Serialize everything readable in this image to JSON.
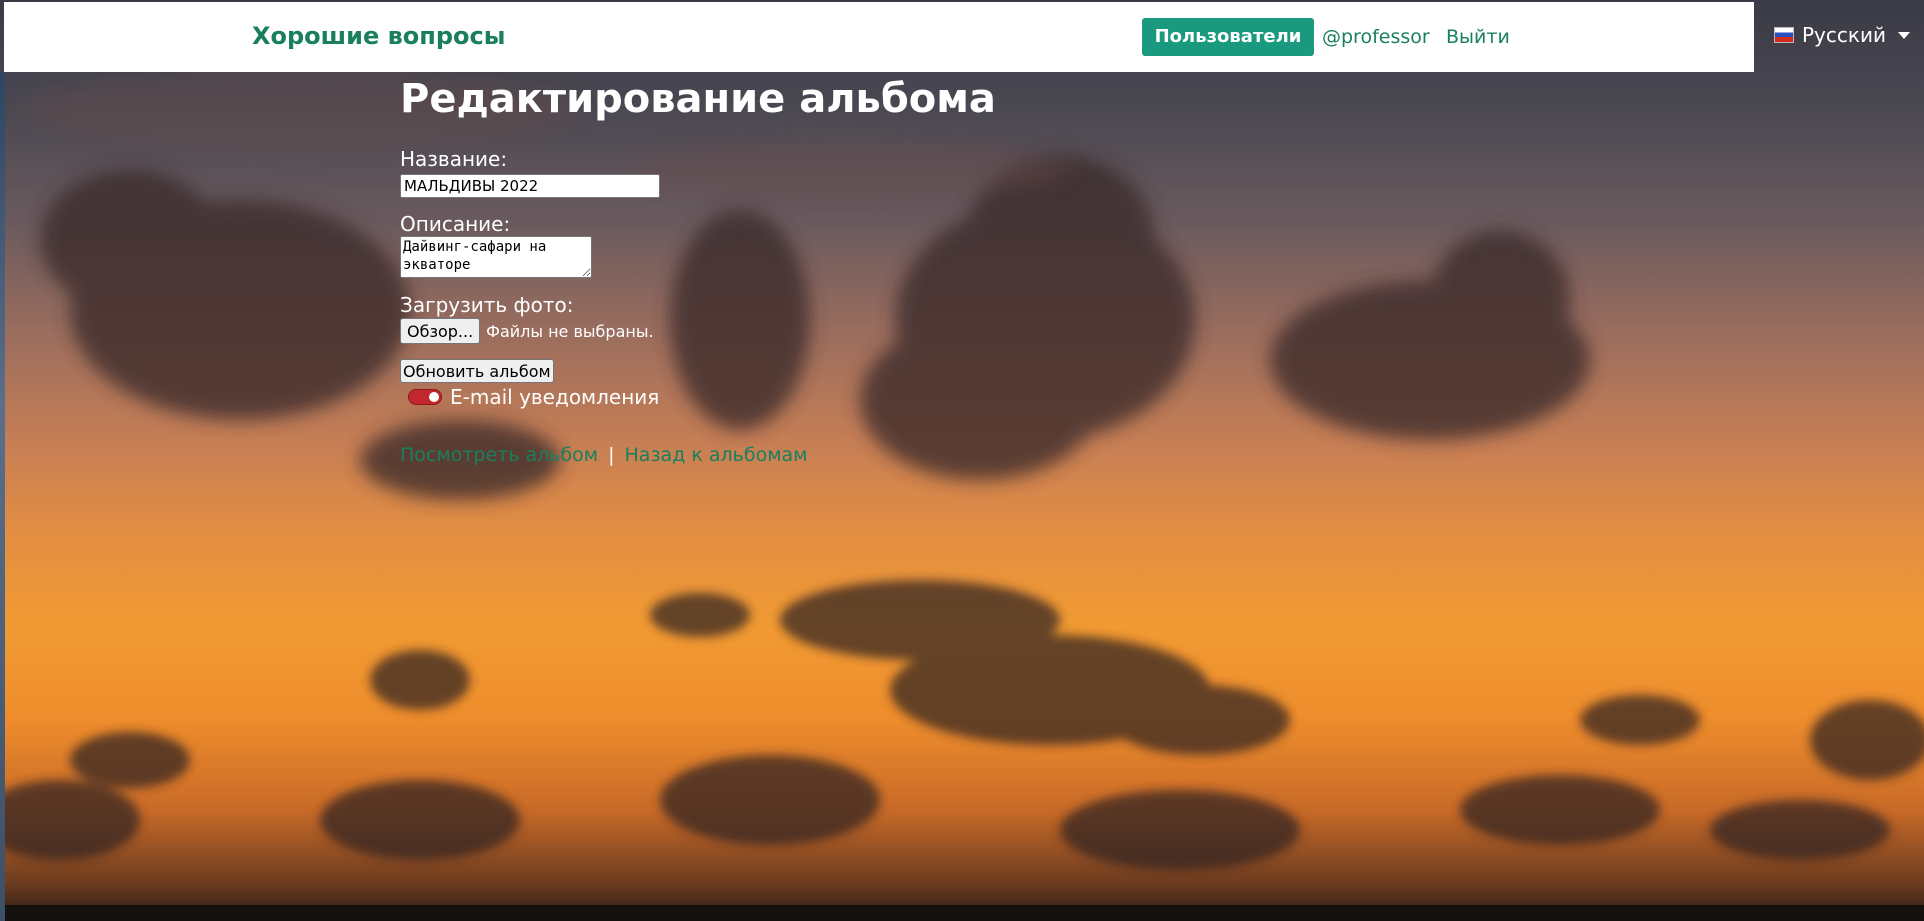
{
  "navbar": {
    "brand": "Хорошие вопросы",
    "users_button": "Пользователи",
    "profile_link": "@professor",
    "logout_link": "Выйти"
  },
  "language": {
    "selected": "Русский",
    "flag_icon": "russia-flag-icon",
    "caret_icon": "chevron-down-icon"
  },
  "form": {
    "title": "Редактирование альбома",
    "name_label": "Название:",
    "name_value": "МАЛЬДИВЫ 2022",
    "description_label": "Описание:",
    "description_value": "Дайвинг-сафари на экваторе",
    "upload_label": "Загрузить фото:",
    "browse_button": "Обзор...",
    "file_status": "Файлы не выбраны.",
    "update_button": "Обновить альбом",
    "email_toggle_label": "E-mail уведомления",
    "email_toggle_on": true
  },
  "links": {
    "view_album": "Посмотреть альбом",
    "separator": "|",
    "back_to_albums": "Назад к альбомам"
  },
  "colors": {
    "brand_green": "#1a7f5e",
    "button_teal": "#199a7f",
    "toggle_red": "#c2272d"
  }
}
